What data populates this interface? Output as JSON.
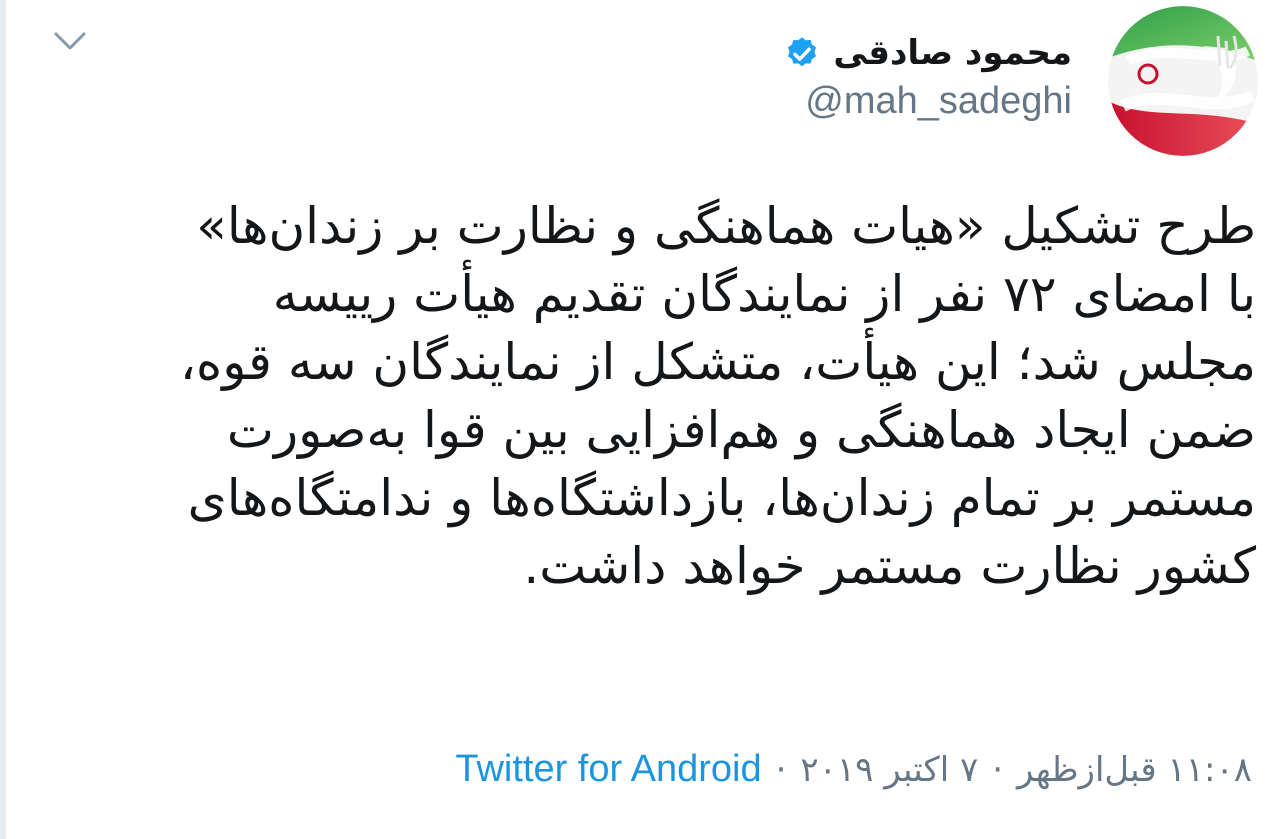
{
  "tweet": {
    "display_name": "محمود صادقی",
    "handle": "@mah_sadeghi",
    "verified": true,
    "avatar_icon": "iran-flag-avatar",
    "body_lines": [
      "طرح تشکیل «هیات هماهنگی و نظارت بر زندان‌ها»",
      "با امضای ۷۲ نفر از نمایندگان تقدیم هیأت رییسه",
      "مجلس شد؛ این هیأت، متشکل از نمایندگان سه قوه،",
      "ضمن ایجاد هماهنگی و هم‌افزایی بین قوا به‌صورت",
      "مستمر بر تمام زندان‌ها، بازداشتگاه‌ها و ندامتگاه‌های",
      "کشور نظارت مستمر خواهد داشت."
    ],
    "time": "۱۱:۰۸ قبل‌ازظهر",
    "date": "۷ اکتبر ۲۰۱۹",
    "separator": "·",
    "source": "Twitter for Android"
  },
  "colors": {
    "text": "#14171a",
    "secondary": "#657786",
    "link": "#1b95e0",
    "verified": "#1da1f2"
  },
  "icons": [
    "chevron-down-icon",
    "verified-badge-icon"
  ]
}
